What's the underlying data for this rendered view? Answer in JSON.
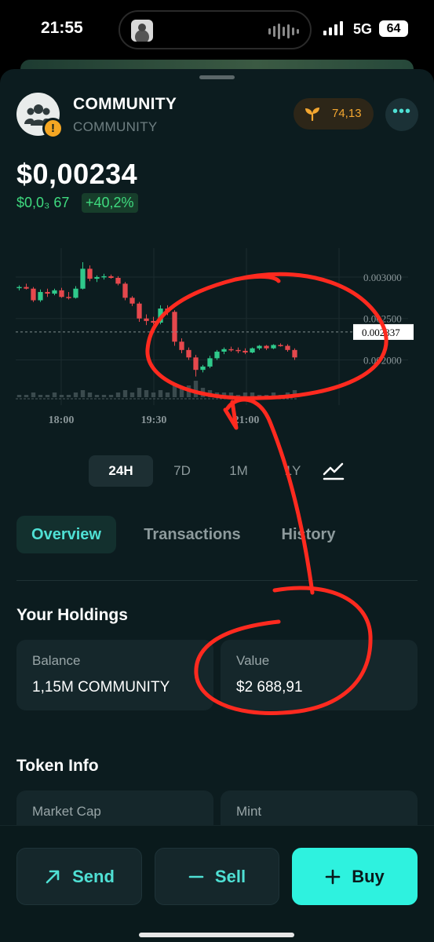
{
  "status_bar": {
    "time": "21:55",
    "network": "5G",
    "battery": "64"
  },
  "token": {
    "name": "COMMUNITY",
    "symbol": "COMMUNITY",
    "warning_icon": "exclamation-icon",
    "score": "74,13",
    "more_label": "•••",
    "price": "$0,00234",
    "change_amount": "$0,0₃ 67",
    "change_percent": "+40,2%"
  },
  "chart_data": {
    "type": "candlestick",
    "time_labels": [
      "18:00",
      "19:30",
      "21:00"
    ],
    "y_tick_labels": [
      "0.003000",
      "0.002500",
      "0.002000"
    ],
    "current_price_label": "0.002337",
    "ohlc": [
      {
        "o": 0.00287,
        "h": 0.0029,
        "l": 0.00284,
        "c": 0.00288
      },
      {
        "o": 0.00288,
        "h": 0.00292,
        "l": 0.00285,
        "c": 0.00286
      },
      {
        "o": 0.00286,
        "h": 0.00288,
        "l": 0.0027,
        "c": 0.00272
      },
      {
        "o": 0.00272,
        "h": 0.00285,
        "l": 0.0027,
        "c": 0.00282
      },
      {
        "o": 0.00282,
        "h": 0.00286,
        "l": 0.00276,
        "c": 0.0028
      },
      {
        "o": 0.0028,
        "h": 0.00286,
        "l": 0.00278,
        "c": 0.00284
      },
      {
        "o": 0.00284,
        "h": 0.00287,
        "l": 0.00275,
        "c": 0.00276
      },
      {
        "o": 0.00276,
        "h": 0.00282,
        "l": 0.00273,
        "c": 0.00275
      },
      {
        "o": 0.00275,
        "h": 0.00289,
        "l": 0.00274,
        "c": 0.00286
      },
      {
        "o": 0.00286,
        "h": 0.00318,
        "l": 0.00285,
        "c": 0.0031
      },
      {
        "o": 0.0031,
        "h": 0.00314,
        "l": 0.00295,
        "c": 0.00298
      },
      {
        "o": 0.00298,
        "h": 0.00302,
        "l": 0.00294,
        "c": 0.003
      },
      {
        "o": 0.003,
        "h": 0.00304,
        "l": 0.00297,
        "c": 0.00301
      },
      {
        "o": 0.00301,
        "h": 0.00303,
        "l": 0.00298,
        "c": 0.00299
      },
      {
        "o": 0.00299,
        "h": 0.00301,
        "l": 0.0029,
        "c": 0.00292
      },
      {
        "o": 0.00292,
        "h": 0.00294,
        "l": 0.00272,
        "c": 0.00275
      },
      {
        "o": 0.00275,
        "h": 0.00277,
        "l": 0.00265,
        "c": 0.00268
      },
      {
        "o": 0.00268,
        "h": 0.0027,
        "l": 0.00246,
        "c": 0.0025
      },
      {
        "o": 0.0025,
        "h": 0.00255,
        "l": 0.00242,
        "c": 0.00247
      },
      {
        "o": 0.00247,
        "h": 0.00252,
        "l": 0.00243,
        "c": 0.00245
      },
      {
        "o": 0.00245,
        "h": 0.00266,
        "l": 0.00243,
        "c": 0.00262
      },
      {
        "o": 0.00262,
        "h": 0.00266,
        "l": 0.00254,
        "c": 0.00258
      },
      {
        "o": 0.00258,
        "h": 0.0026,
        "l": 0.00217,
        "c": 0.00222
      },
      {
        "o": 0.00222,
        "h": 0.00226,
        "l": 0.00208,
        "c": 0.00212
      },
      {
        "o": 0.00212,
        "h": 0.00215,
        "l": 0.002,
        "c": 0.00203
      },
      {
        "o": 0.00203,
        "h": 0.00206,
        "l": 0.0018,
        "c": 0.00188
      },
      {
        "o": 0.00188,
        "h": 0.00194,
        "l": 0.00185,
        "c": 0.00192
      },
      {
        "o": 0.00192,
        "h": 0.00205,
        "l": 0.0019,
        "c": 0.00202
      },
      {
        "o": 0.00202,
        "h": 0.00212,
        "l": 0.002,
        "c": 0.0021
      },
      {
        "o": 0.0021,
        "h": 0.00215,
        "l": 0.00207,
        "c": 0.00213
      },
      {
        "o": 0.00213,
        "h": 0.00216,
        "l": 0.0021,
        "c": 0.00212
      },
      {
        "o": 0.00212,
        "h": 0.00215,
        "l": 0.00208,
        "c": 0.00211
      },
      {
        "o": 0.00211,
        "h": 0.00214,
        "l": 0.00207,
        "c": 0.00209
      },
      {
        "o": 0.00209,
        "h": 0.00215,
        "l": 0.00208,
        "c": 0.00214
      },
      {
        "o": 0.00214,
        "h": 0.00218,
        "l": 0.00212,
        "c": 0.00217
      },
      {
        "o": 0.00217,
        "h": 0.00218,
        "l": 0.00212,
        "c": 0.00214
      },
      {
        "o": 0.00214,
        "h": 0.00219,
        "l": 0.00213,
        "c": 0.00218
      },
      {
        "o": 0.00218,
        "h": 0.0022,
        "l": 0.00216,
        "c": 0.00217
      },
      {
        "o": 0.00217,
        "h": 0.00219,
        "l": 0.0021,
        "c": 0.00212
      },
      {
        "o": 0.00212,
        "h": 0.00214,
        "l": 0.002,
        "c": 0.00203
      }
    ],
    "volume": [
      1,
      1,
      2,
      1,
      1,
      2,
      1,
      1,
      2,
      3,
      2,
      1,
      1,
      1,
      2,
      3,
      2,
      4,
      3,
      2,
      3,
      2,
      6,
      4,
      5,
      7,
      4,
      3,
      2,
      2,
      2,
      1,
      2,
      2,
      1,
      1,
      2,
      1,
      2,
      3
    ],
    "colors": {
      "up": "#2fc98b",
      "down": "#e5484d",
      "grid": "#1b2b2f"
    },
    "ylim": [
      0.00155,
      0.00335
    ],
    "grid": true,
    "legend": "none"
  },
  "ranges": [
    "24H",
    "7D",
    "1M",
    "1Y"
  ],
  "range_icon": "line-chart-icon",
  "tabs": [
    "Overview",
    "Transactions",
    "History"
  ],
  "holdings": {
    "title": "Your Holdings",
    "balance_label": "Balance",
    "balance_value": "1,15M COMMUNITY",
    "value_label": "Value",
    "value_value": "$2 688,91"
  },
  "token_info": {
    "title": "Token Info",
    "market_cap_label": "Market Cap",
    "mint_label": "Mint"
  },
  "actions": {
    "send": "Send",
    "sell": "Sell",
    "buy": "Buy"
  },
  "colors": {
    "accent": "#2ef2df",
    "background": "#0c1c1f",
    "positive": "#3fdb7f",
    "score": "#f3a630",
    "annotation": "#ff2a1f"
  }
}
